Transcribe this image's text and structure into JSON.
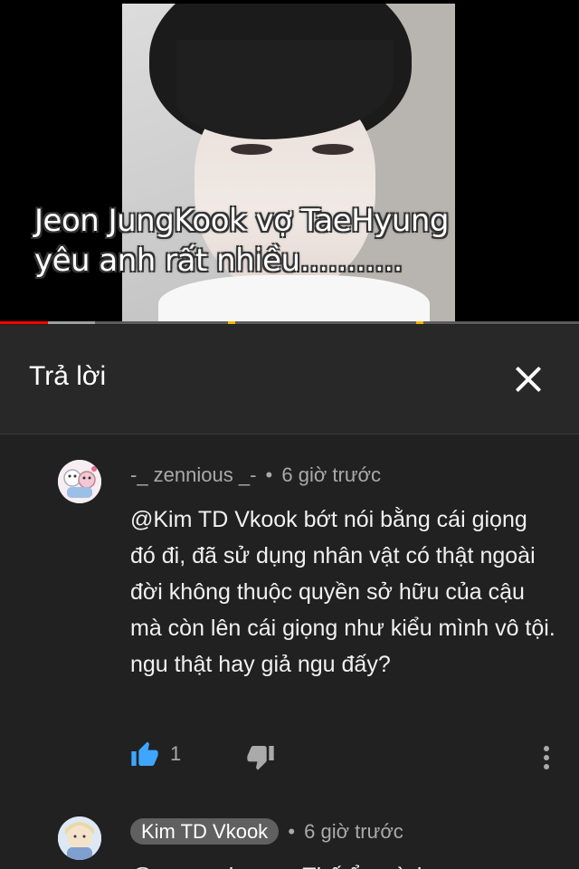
{
  "video": {
    "overlay_line1": "Jeon JungKook vợ TaeHyung",
    "overlay_line2": "yêu anh rất nhiều...........",
    "progress_played_fraction": 0.083,
    "progress_buffered_fraction": 0.164
  },
  "replies_header": {
    "title": "Trả lời",
    "close_icon": "close-icon"
  },
  "comments": [
    {
      "author": "-_ zennious _-",
      "separator": "•",
      "time": "6 giờ trước",
      "text": "@Kim TD Vkook bớt nói bằng cái giọng đó đi, đã sử dụng nhân vật có thật ngoài đời không thuộc quyền sở hữu của cậu mà còn lên cái giọng như kiểu mình vô tội. ngu thật hay giả ngu đấy?",
      "likes": "1",
      "liked": true,
      "accent_color": "#3ea6ff"
    },
    {
      "author": "Kim TD Vkook",
      "separator": "•",
      "time": "6 giờ trước",
      "text": "@-_ zennious _- Thế ổn mình"
    }
  ]
}
